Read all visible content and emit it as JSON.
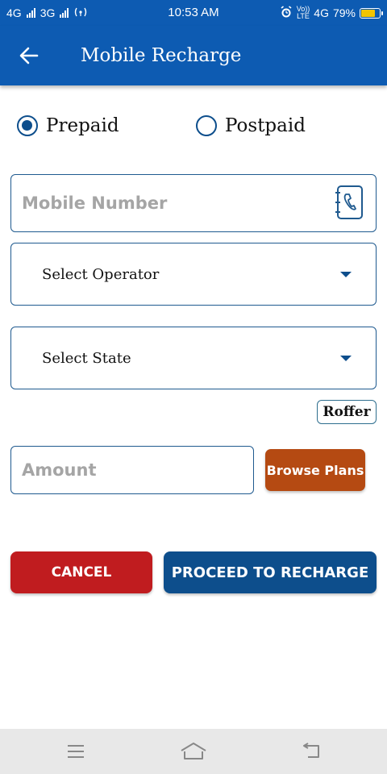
{
  "status_bar": {
    "sim1": "4G",
    "sim2": "3G",
    "time": "10:53 AM",
    "volte_top": "Vo))",
    "volte_bottom": "LTE",
    "network": "4G",
    "battery": "79%",
    "battery_level": 0.79,
    "battery_color": "#f2c400"
  },
  "app_bar": {
    "title": "Mobile Recharge",
    "back_icon": "arrow-left-icon",
    "color": "#0d5bb2"
  },
  "recharge_type": {
    "options": [
      {
        "label": "Prepaid",
        "selected": true
      },
      {
        "label": "Postpaid",
        "selected": false
      }
    ]
  },
  "form": {
    "mobile_placeholder": "Mobile Number",
    "contact_icon": "contact-book-icon",
    "operator_label": "Select Operator",
    "state_label": "Select State",
    "roffer_label": "Roffer",
    "amount_placeholder": "Amount",
    "browse_plans_label": "Browse Plans"
  },
  "actions": {
    "cancel_label": "CANCEL",
    "proceed_label": "PROCEED TO RECHARGE",
    "cancel_color": "#c01c1f",
    "proceed_color": "#0d4e8c",
    "browse_color": "#b54a12"
  },
  "nav_bar": {
    "menu_icon": "menu-icon",
    "home_icon": "home-icon",
    "back_icon": "back-return-icon"
  }
}
